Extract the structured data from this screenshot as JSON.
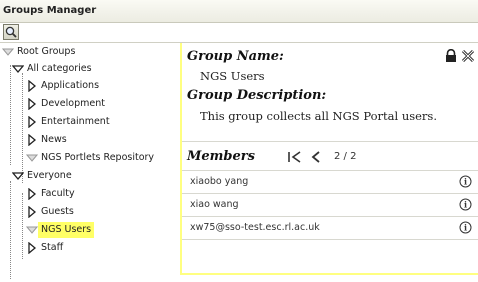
{
  "window": {
    "title": "Groups Manager"
  },
  "toolbar": {
    "search_icon": "magnifier-icon"
  },
  "tree": {
    "root": "Root Groups",
    "all_categories": "All categories",
    "applications": "Applications",
    "development": "Development",
    "entertainment": "Entertainment",
    "news": "News",
    "ngs_portlets": "NGS Portlets Repository",
    "everyone": "Everyone",
    "faculty": "Faculty",
    "guests": "Guests",
    "ngs_users": "NGS Users",
    "staff": "Staff"
  },
  "group": {
    "name_label": "Group Name:",
    "name": "NGS Users",
    "desc_label": "Group Description:",
    "description": "This group collects all NGS Portal users."
  },
  "members": {
    "heading": "Members",
    "page": "2 / 2",
    "rows": [
      "xiaobo yang",
      "xiao wang",
      "xw75@sso-test.esc.rl.ac.uk"
    ]
  },
  "colors": {
    "selection": "#ffff66",
    "pane_border": "#ffff80",
    "tree_lines": "#888888"
  }
}
